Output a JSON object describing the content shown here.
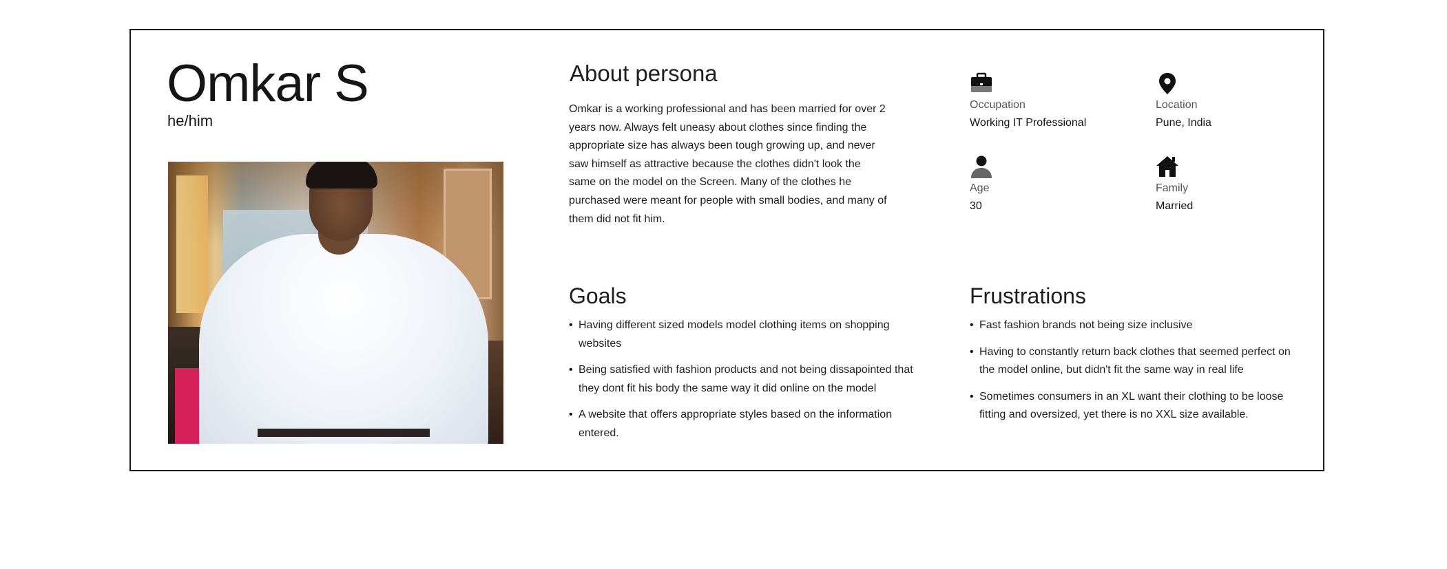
{
  "persona": {
    "name": "Omkar S",
    "pronouns": "he/him"
  },
  "about": {
    "title": "About persona",
    "text": "Omkar is a working professional and has been married for over 2 years now. Always felt uneasy about clothes since finding the appropriate size has always been tough growing up, and never saw himself as attractive because the clothes didn't look the same on the model on the Screen. Many of the clothes he purchased were meant for people with small bodies, and many of them did not fit him."
  },
  "details": {
    "occupation": {
      "label": "Occupation",
      "value": "Working IT Professional",
      "icon": "briefcase-icon"
    },
    "location": {
      "label": "Location",
      "value": "Pune, India",
      "icon": "location-pin-icon"
    },
    "age": {
      "label": "Age",
      "value": "30",
      "icon": "person-icon"
    },
    "family": {
      "label": "Family",
      "value": "Married",
      "icon": "home-icon"
    }
  },
  "goals": {
    "title": "Goals",
    "items": [
      "Having different sized models model clothing items on shopping websites",
      "Being satisfied with fashion products and not being dissapointed that they dont fit his body the same way it did online on the model",
      "A website that offers appropriate styles based on the information entered."
    ]
  },
  "frustrations": {
    "title": "Frustrations",
    "items": [
      "Fast fashion brands not being size inclusive",
      "Having to constantly return back clothes that seemed perfect on the model online, but didn't fit the same way in real life",
      "Sometimes consumers in an XL want their clothing to be loose fitting and oversized, yet there is no XXL size available."
    ]
  }
}
